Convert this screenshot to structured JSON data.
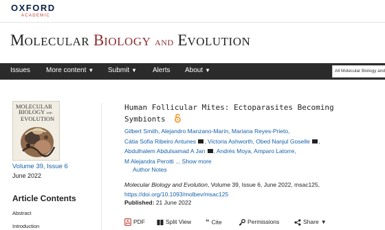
{
  "publisher": {
    "name": "OXFORD",
    "sub": "ACADEMIC"
  },
  "journal": {
    "word1_cap": "M",
    "word1_rest": "OLECULAR",
    "word2_cap": "B",
    "word2_rest": "IOLOGY",
    "word3": "AND",
    "word4_cap": "E",
    "word4_rest": "VOLUTION"
  },
  "nav": {
    "items": [
      "Issues",
      "More content",
      "Submit",
      "Alerts",
      "About"
    ],
    "search_placeholder": "All Molecular Biology and Evolution"
  },
  "cover": {
    "line1": "MOLECULAR",
    "line2": "BIOLOGY",
    "line3": "EVOLUTION",
    "and": "AND"
  },
  "issue": {
    "volume": "Volume 39, Issue 6",
    "date": "June 2022"
  },
  "article_contents": {
    "heading": "Article Contents",
    "items": [
      "Abstract",
      "Introduction"
    ]
  },
  "article": {
    "title_line1": "Human Follicular Mites: Ectoparasites Becoming",
    "title_line2": "Symbionts",
    "authors_line1": "Gilbert Smith, Alejandro Manzano-Marín, Mariana Reyes-Prieto,",
    "authors_line2a": "Cátia Sofia Ribeiro Antunes",
    "authors_line2b": ", Victoria Ashworth, Obed Nanjul Goselle",
    "authors_line2c": ",",
    "authors_line3a": "Abdulhalem Abdulsamad A Jan",
    "authors_line3b": ", Andrés Moya, Amparo Latorre,",
    "authors_line4": "M Alejandra Perotti",
    "show_more": "... Show more",
    "author_notes": "Author Notes",
    "citation_journal": "Molecular Biology and Evolution",
    "citation_rest": ", Volume 39, Issue 6, June 2022, msac125,",
    "doi": "https://doi.org/10.1093/molbev/msac125",
    "published_label": "Published:",
    "published_date": "21 June 2022"
  },
  "toolbar": {
    "pdf": "PDF",
    "split_view": "Split View",
    "cite": "Cite",
    "permissions": "Permissions",
    "share": "Share"
  },
  "colors": {
    "nav_bg": "#2b2b2b",
    "link": "#1560a8",
    "oa_orange": "#f7931e",
    "title_red": "#8b2e2e"
  }
}
